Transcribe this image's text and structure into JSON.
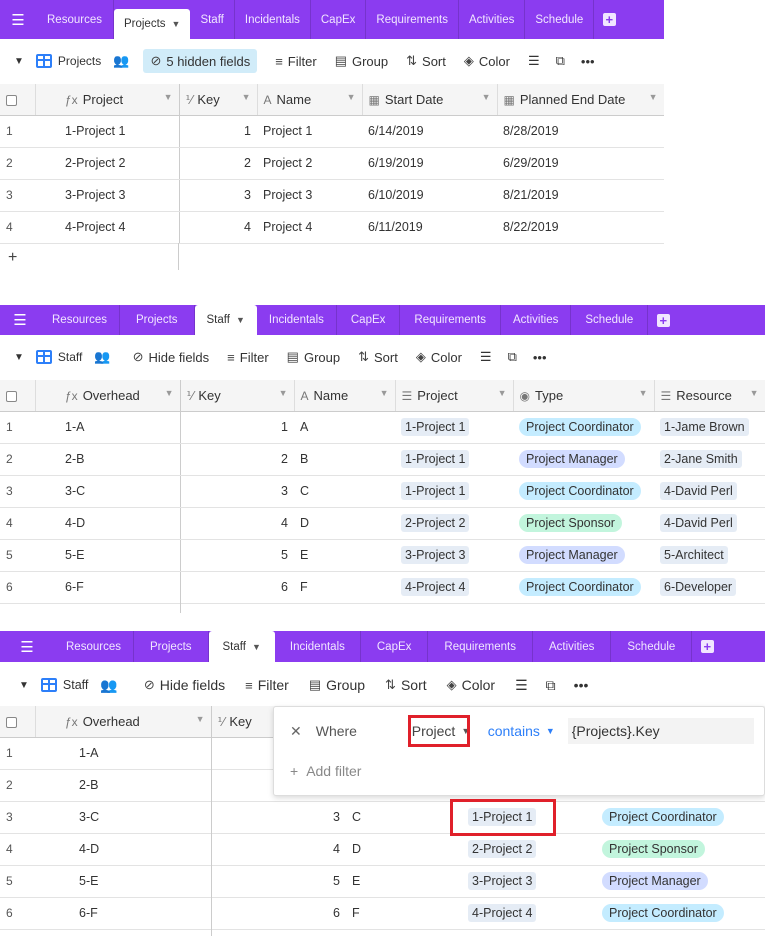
{
  "tabs": [
    "Resources",
    "Projects",
    "Staff",
    "Incidentals",
    "CapEx",
    "Requirements",
    "Activities",
    "Schedule"
  ],
  "panel1": {
    "active_tab": "Projects",
    "view_name": "Projects",
    "hidden_fields": "5 hidden fields",
    "toolbar": {
      "filter": "Filter",
      "group": "Group",
      "sort": "Sort",
      "color": "Color"
    },
    "columns": [
      "Project",
      "Key",
      "Name",
      "Start Date",
      "Planned End Date"
    ],
    "rows": [
      {
        "n": "1",
        "project": "1-Project 1",
        "key": "1",
        "name": "Project 1",
        "start": "6/14/2019",
        "end": "8/28/2019"
      },
      {
        "n": "2",
        "project": "2-Project 2",
        "key": "2",
        "name": "Project 2",
        "start": "6/19/2019",
        "end": "6/29/2019"
      },
      {
        "n": "3",
        "project": "3-Project 3",
        "key": "3",
        "name": "Project 3",
        "start": "6/10/2019",
        "end": "8/21/2019"
      },
      {
        "n": "4",
        "project": "4-Project 4",
        "key": "4",
        "name": "Project 4",
        "start": "6/11/2019",
        "end": "8/22/2019"
      }
    ]
  },
  "panel2": {
    "active_tab": "Staff",
    "view_name": "Staff",
    "toolbar": {
      "hide_fields": "Hide fields",
      "filter": "Filter",
      "group": "Group",
      "sort": "Sort",
      "color": "Color"
    },
    "columns": [
      "Overhead",
      "Key",
      "Name",
      "Project",
      "Type",
      "Resource"
    ],
    "rows": [
      {
        "n": "1",
        "overhead": "1-A",
        "key": "1",
        "name": "A",
        "project": "1-Project 1",
        "type": "Project Coordinator",
        "resource": "1-Jame Brown"
      },
      {
        "n": "2",
        "overhead": "2-B",
        "key": "2",
        "name": "B",
        "project": "1-Project 1",
        "type": "Project Manager",
        "resource": "2-Jane Smith"
      },
      {
        "n": "3",
        "overhead": "3-C",
        "key": "3",
        "name": "C",
        "project": "1-Project 1",
        "type": "Project Coordinator",
        "resource": "4-David Perl"
      },
      {
        "n": "4",
        "overhead": "4-D",
        "key": "4",
        "name": "D",
        "project": "2-Project 2",
        "type": "Project Sponsor",
        "resource": "4-David Perl"
      },
      {
        "n": "5",
        "overhead": "5-E",
        "key": "5",
        "name": "E",
        "project": "3-Project 3",
        "type": "Project Manager",
        "resource": "5-Architect"
      },
      {
        "n": "6",
        "overhead": "6-F",
        "key": "6",
        "name": "F",
        "project": "4-Project 4",
        "type": "Project Coordinator",
        "resource": "6-Developer"
      }
    ]
  },
  "panel3": {
    "active_tab": "Staff",
    "view_name": "Staff",
    "toolbar": {
      "hide_fields": "Hide fields",
      "filter": "Filter",
      "group": "Group",
      "sort": "Sort",
      "color": "Color"
    },
    "columns": [
      "Overhead",
      "Key"
    ],
    "filter": {
      "where": "Where",
      "field": "Project",
      "operator": "contains",
      "value": "{Projects}.Key",
      "add": "Add filter"
    },
    "rows": [
      {
        "n": "1",
        "overhead": "1-A",
        "key": "",
        "name": "",
        "project": "",
        "type": ""
      },
      {
        "n": "2",
        "overhead": "2-B",
        "key": "",
        "name": "",
        "project": "",
        "type": ""
      },
      {
        "n": "3",
        "overhead": "3-C",
        "key": "3",
        "name": "C",
        "project": "1-Project 1",
        "type": "Project Coordinator"
      },
      {
        "n": "4",
        "overhead": "4-D",
        "key": "4",
        "name": "D",
        "project": "2-Project 2",
        "type": "Project Sponsor"
      },
      {
        "n": "5",
        "overhead": "5-E",
        "key": "5",
        "name": "E",
        "project": "3-Project 3",
        "type": "Project Manager"
      },
      {
        "n": "6",
        "overhead": "6-F",
        "key": "6",
        "name": "F",
        "project": "4-Project 4",
        "type": "Project Coordinator"
      }
    ]
  }
}
